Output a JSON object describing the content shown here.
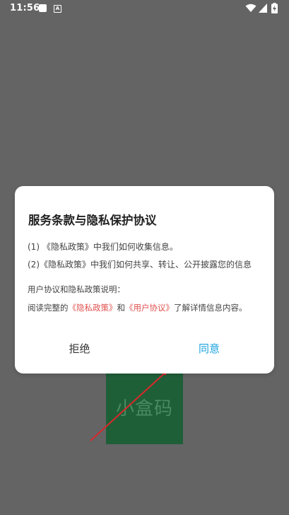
{
  "status_bar": {
    "time": "11:56",
    "icons": [
      "notification-square-icon",
      "accessibility-a-icon",
      "wifi-icon",
      "cellular-signal-icon",
      "battery-charging-icon"
    ],
    "a_glyph": "A"
  },
  "background": {
    "logo_text": "小盒码",
    "logo_color": "#1f5f38",
    "arrow_color": "#d9282b"
  },
  "dialog": {
    "title": "服务条款与隐私保护协议",
    "items": [
      "(1) 《隐私政策》中我们如何收集信息。",
      "(2)《隐私政策》中我们如何共享、转让、公开披露您的信息"
    ],
    "intro": "用户协议和隐私政策说明：",
    "read_prefix": "阅读完整的",
    "privacy_link": "《隐私政策》",
    "read_and": "和",
    "user_agreement_link": "《用户协议》",
    "read_suffix": "了解详情信息内容。",
    "reject_label": "拒绝",
    "agree_label": "同意"
  },
  "colors": {
    "overlay_bg": "#646464",
    "link": "#e0524f",
    "agree": "#1aa3e0"
  }
}
